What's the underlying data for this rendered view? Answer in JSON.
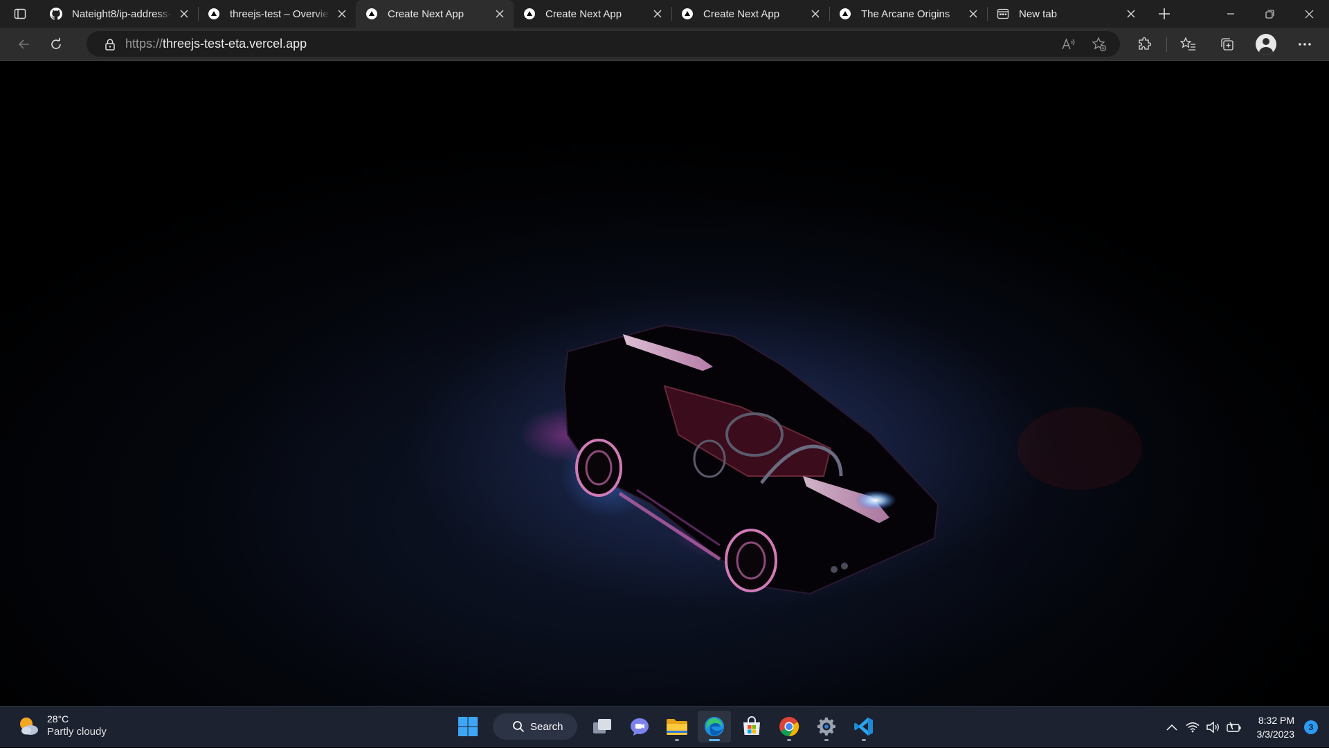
{
  "browser": {
    "tabs": [
      {
        "title": "Nateight8/ip-address-",
        "favicon": "github-icon",
        "active": false
      },
      {
        "title": "threejs-test – Overview",
        "favicon": "vercel-icon",
        "active": false
      },
      {
        "title": "Create Next App",
        "favicon": "vercel-icon",
        "active": true
      },
      {
        "title": "Create Next App",
        "favicon": "vercel-icon",
        "active": false
      },
      {
        "title": "Create Next App",
        "favicon": "vercel-icon",
        "active": false
      },
      {
        "title": "The Arcane Origins",
        "favicon": "vercel-icon",
        "active": false
      },
      {
        "title": "New tab",
        "favicon": "newtab-page-icon",
        "active": false
      }
    ],
    "address": {
      "protocol": "https://",
      "host": "threejs-test-eta.vercel.app"
    }
  },
  "taskbar": {
    "weather": {
      "temperature": "28°C",
      "condition": "Partly cloudy"
    },
    "search_label": "Search",
    "pinned_apps": [
      "task-view",
      "teams-chat",
      "file-explorer",
      "edge",
      "microsoft-store",
      "chrome",
      "settings",
      "vscode"
    ],
    "clock": {
      "time": "8:32 PM",
      "date": "3/3/2023"
    },
    "notification_count": "3"
  },
  "colors": {
    "tabstrip_bg": "#202020",
    "active_tab_bg": "#2d2d2d",
    "taskbar_bg": "#1c2230",
    "scene_bg": "#000000",
    "accent": "#5db4ff"
  }
}
